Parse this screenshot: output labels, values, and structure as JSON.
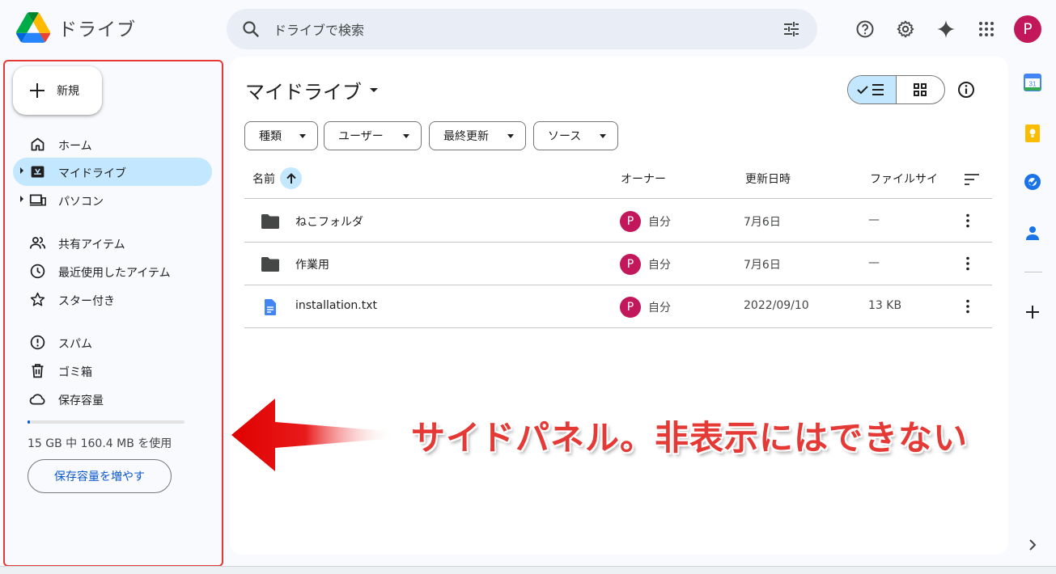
{
  "app": {
    "name": "ドライブ"
  },
  "search": {
    "placeholder": "ドライブで検索"
  },
  "account": {
    "initial": "P",
    "color": "#c2185b"
  },
  "sidebar": {
    "new_label": "新規",
    "items": [
      {
        "label": "ホーム",
        "icon": "home-icon"
      },
      {
        "label": "マイドライブ",
        "icon": "my-drive-icon",
        "active": true
      },
      {
        "label": "パソコン",
        "icon": "computers-icon"
      },
      {
        "label": "共有アイテム",
        "icon": "shared-icon"
      },
      {
        "label": "最近使用したアイテム",
        "icon": "clock-icon"
      },
      {
        "label": "スター付き",
        "icon": "star-icon"
      },
      {
        "label": "スパム",
        "icon": "spam-icon"
      },
      {
        "label": "ゴミ箱",
        "icon": "trash-icon"
      },
      {
        "label": "保存容量",
        "icon": "cloud-icon"
      }
    ],
    "storage_text": "15 GB 中 160.4 MB を使用",
    "storage_used_fraction": 0.0104,
    "storage_button": "保存容量を増やす"
  },
  "main": {
    "title": "マイドライブ",
    "filters": [
      "種類",
      "ユーザー",
      "最終更新",
      "ソース"
    ],
    "columns": {
      "name": "名前",
      "owner": "オーナー",
      "modified": "更新日時",
      "size": "ファイルサイ"
    },
    "files": [
      {
        "name": "ねこフォルダ",
        "type": "folder",
        "owner": "自分",
        "owner_initial": "P",
        "modified": "7月6日",
        "size": "—"
      },
      {
        "name": "作業用",
        "type": "folder",
        "owner": "自分",
        "owner_initial": "P",
        "modified": "7月6日",
        "size": "—"
      },
      {
        "name": "installation.txt",
        "type": "document",
        "owner": "自分",
        "owner_initial": "P",
        "modified": "2022/09/10",
        "size": "13 KB"
      }
    ]
  },
  "annotation": {
    "text": "サイドパネル。非表示にはできない",
    "color": "#e53935"
  },
  "colors": {
    "accent": "#0b57d0",
    "active_bg": "#c2e7ff",
    "search_bg": "#e9eef6",
    "page_bg": "#f8fafd"
  }
}
